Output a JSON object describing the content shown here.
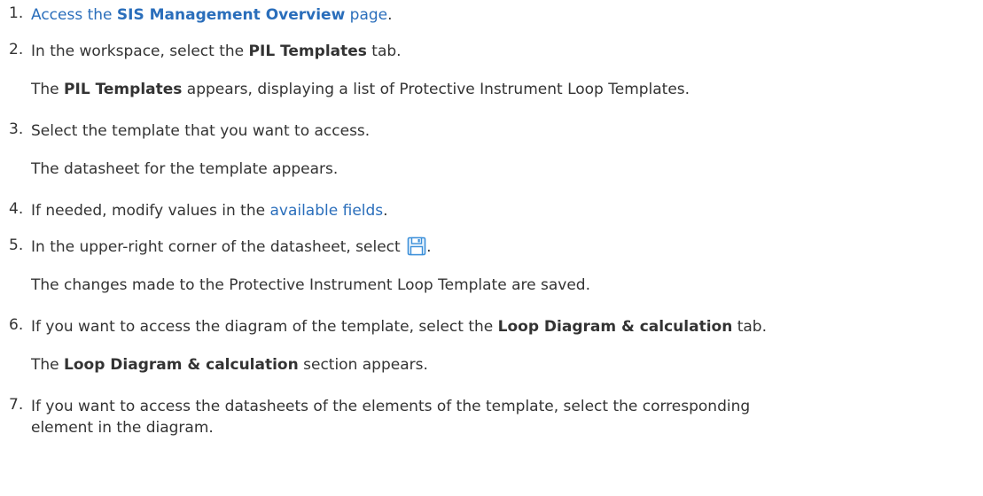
{
  "steps": [
    {
      "number": "1.",
      "link_prefix": "Access the ",
      "link_bold": "SIS Management Overview",
      "link_suffix": " page",
      "after": "."
    },
    {
      "number": "2.",
      "pre": "In the workspace, select the ",
      "bold": "PIL Templates",
      "post": " tab.",
      "result_bold": "PIL Templates",
      "result_post": " appears, displaying a list of Protective Instrument Loop Templates.",
      "result_pre": "The "
    },
    {
      "number": "3.",
      "text": "Select the template that you want to access.",
      "result": "The datasheet for the template appears."
    },
    {
      "number": "4.",
      "pre": "If needed, modify values in the ",
      "link": "available fields",
      "post": "."
    },
    {
      "number": "5.",
      "pre": "In the upper-right corner of the datasheet, select ",
      "post": ".",
      "icon": "save-icon",
      "result": "The changes made to the Protective Instrument Loop Template are saved."
    },
    {
      "number": "6.",
      "pre": "If you want to access the diagram of the template, select the ",
      "bold": "Loop Diagram & calculation",
      "post": " tab.",
      "result_pre": "The ",
      "result_bold": "Loop Diagram & calculation",
      "result_post": " section appears."
    },
    {
      "number": "7.",
      "line1": "If you want to access the datasheets of the elements of the template, select the corresponding",
      "line2": "element in the diagram."
    }
  ],
  "colors": {
    "text": "#333333",
    "link": "#2a6ebb",
    "icon": "#3b8fd9"
  }
}
